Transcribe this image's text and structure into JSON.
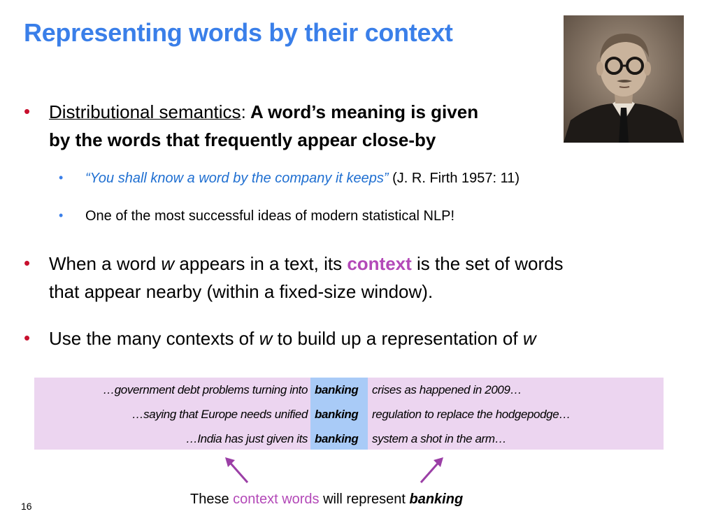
{
  "slide": {
    "title": "Representing words by their context",
    "page_number": "16"
  },
  "bullet1": {
    "term": "Distributional semantics",
    "colon": ":",
    "bold_a": " A word’s meaning is given",
    "bold_b": "by the words that frequently appear close-by"
  },
  "sub1": {
    "quote": "“You shall know a word by the company it keeps”",
    "citation": " (J. R. Firth 1957: 11)"
  },
  "sub2": {
    "text": "One of the most successful ideas of modern statistical NLP!"
  },
  "bullet2": {
    "pre": "When a word ",
    "w": "w",
    "mid": " appears in a text, its ",
    "context": "context",
    "post": " is the set of words",
    "line2": "that appear nearby (within a fixed-size window)."
  },
  "bullet3": {
    "pre": "Use the many contexts of ",
    "w1": "w",
    "mid": " to build up a representation of ",
    "w2": "w"
  },
  "kwic": {
    "rows": [
      {
        "left": "…government debt problems turning into",
        "keyword": "banking",
        "right": "crises as happened in 2009…"
      },
      {
        "left": "…saying that Europe needs unified",
        "keyword": "banking",
        "right": "regulation to replace the hodgepodge…"
      },
      {
        "left": "…India has just given its",
        "keyword": "banking",
        "right": "system a shot in the arm…"
      }
    ]
  },
  "caption": {
    "pre": "These ",
    "context_words": "context words",
    "mid": " will represent ",
    "target": "banking"
  },
  "colors": {
    "title": "#3a7fe9",
    "bullet": "#c8102e",
    "context": "#b349b8",
    "quote": "#1f6fd1",
    "panel": "#ecd5f0",
    "keyword_column": "#a9cbf7"
  }
}
